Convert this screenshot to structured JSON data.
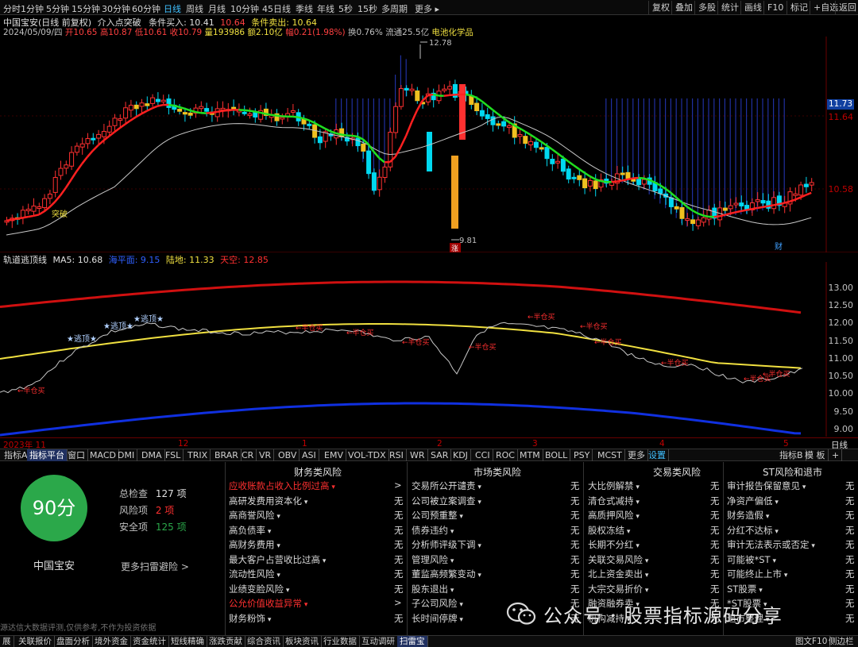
{
  "topbar": {
    "periods": [
      "分时",
      "1分钟",
      "5分钟",
      "15分钟",
      "30分钟",
      "60分钟",
      "日线",
      "周线",
      "月线",
      "10分钟",
      "45日线",
      "季线",
      "年线",
      "5秒",
      "15秒",
      "多周期",
      "更多 ▸"
    ],
    "right_buttons": [
      "复权",
      "叠加",
      "多股",
      "统计",
      "画线",
      "F10",
      "标记",
      "+自选",
      "返回"
    ],
    "active": "日线"
  },
  "main": {
    "title": "中国宝安(日线 前复权)",
    "cond1_label": "介入点突破",
    "cond2_label": "条件买入: 10.41",
    "cond2_extra": "10.64",
    "cond3_label": "条件卖出: 10.64",
    "info": {
      "date": "2024/05/09/四",
      "open": "开10.65",
      "high": "高10.87",
      "low": "低10.61",
      "close": "收10.79",
      "vol": "量193986",
      "amount": "额2.10亿",
      "change": "幅0.21(1.98%)",
      "turnover": "换0.76%",
      "float": "流通25.5亿",
      "sector": "电池化学品"
    },
    "y_labels": [
      "11.73",
      "11.64",
      "10.58"
    ],
    "hi_label": "12.78",
    "lo_label": "9.81",
    "break_label": "突破",
    "zhang_label": "涨",
    "cai_label": "财"
  },
  "indicator": {
    "name": "轨道逃顶线",
    "ma5": "MA5: 10.68",
    "sea": "海平面: 9.15",
    "land": "陆地: 11.33",
    "sky": "天空: 12.85",
    "y_labels": [
      "13.00",
      "12.50",
      "12.00",
      "11.50",
      "11.00",
      "10.50",
      "10.00",
      "9.50",
      "9.00"
    ],
    "top_label": "逃顶",
    "buy_label": "←半仓买"
  },
  "xaxis": {
    "labels": [
      "2023年 11",
      "12",
      "1",
      "2",
      "3",
      "4",
      "5"
    ],
    "period_label": "日线"
  },
  "tabs": [
    "指标A",
    "指标平台",
    "窗口",
    "MACD",
    "DMI",
    "DMA",
    "FSL",
    "TRIX",
    "BRAR",
    "CR",
    "VR",
    "OBV",
    "ASI",
    "EMV",
    "VOL-TDX",
    "RSI",
    "WR",
    "SAR",
    "KDJ",
    "CCI",
    "ROC",
    "MTM",
    "BOLL",
    "PSY",
    "MCST",
    "更多",
    "设置"
  ],
  "tabs_right": [
    "指标B",
    "模 板",
    "+"
  ],
  "scan": {
    "score": "90分",
    "stock": "中国宝安",
    "total_label": "总检查",
    "total_value": "127 项",
    "risk_label": "风险项",
    "risk_value": "2 项",
    "safe_label": "安全项",
    "safe_value": "125 项",
    "more": "更多扫雷避险 >",
    "disclaimer": "源达信大数据评测,仅供参考,不作为投资依据",
    "columns": [
      {
        "title": "财务类风险",
        "items": [
          {
            "label": "应收账款占收入比例过高",
            "value": ">",
            "risk": true
          },
          {
            "label": "高研发费用资本化",
            "value": "无"
          },
          {
            "label": "高商誉风险",
            "value": "无"
          },
          {
            "label": "高负债率",
            "value": "无"
          },
          {
            "label": "高财务费用",
            "value": "无"
          },
          {
            "label": "最大客户占营收比过高",
            "value": "无"
          },
          {
            "label": "流动性风险",
            "value": "无"
          },
          {
            "label": "业绩变脸风险",
            "value": "无"
          },
          {
            "label": "公允价值收益异常",
            "value": ">",
            "risk": true
          },
          {
            "label": "财务粉饰",
            "value": "无"
          }
        ]
      },
      {
        "title": "市场类风险",
        "items": [
          {
            "label": "交易所公开谴责",
            "value": "无"
          },
          {
            "label": "公司被立案调查",
            "value": "无"
          },
          {
            "label": "公司预重整",
            "value": "无"
          },
          {
            "label": "债券违约",
            "value": "无"
          },
          {
            "label": "分析师评级下调",
            "value": "无"
          },
          {
            "label": "管理风险",
            "value": "无"
          },
          {
            "label": "董监高频繁变动",
            "value": "无"
          },
          {
            "label": "股东退出",
            "value": "无"
          },
          {
            "label": "子公司风险",
            "value": "无"
          },
          {
            "label": "长时间停牌",
            "value": "无"
          }
        ]
      },
      {
        "title": "交易类风险",
        "items": [
          {
            "label": "大比例解禁",
            "value": "无"
          },
          {
            "label": "清仓式减持",
            "value": "无"
          },
          {
            "label": "高质押风险",
            "value": "无"
          },
          {
            "label": "股权冻结",
            "value": "无"
          },
          {
            "label": "长期不分红",
            "value": "无"
          },
          {
            "label": "关联交易风险",
            "value": "无"
          },
          {
            "label": "北上资金卖出",
            "value": "无"
          },
          {
            "label": "大宗交易折价",
            "value": "无"
          },
          {
            "label": "融资融券卖",
            "value": "无"
          },
          {
            "label": "机构减持",
            "value": "无"
          }
        ]
      },
      {
        "title": "ST风险和退市",
        "items": [
          {
            "label": "审计报告保留意见",
            "value": "无"
          },
          {
            "label": "净资产偏低",
            "value": "无"
          },
          {
            "label": "财务造假",
            "value": "无"
          },
          {
            "label": "分红不达标",
            "value": "无"
          },
          {
            "label": "审计无法表示或否定",
            "value": "无"
          },
          {
            "label": "可能被*ST",
            "value": "无"
          },
          {
            "label": "可能终止上市",
            "value": "无"
          },
          {
            "label": "ST股票",
            "value": "无"
          },
          {
            "label": "*ST股票",
            "value": "无"
          },
          {
            "label": "退市整理",
            "value": "无"
          }
        ]
      }
    ]
  },
  "watermark": "公众号 · 股票指标源码分享",
  "bottom_tabs": [
    "展",
    "关联报价",
    "盘面分析",
    "境外资金",
    "资金统计",
    "短线精确",
    "涨跌贡献",
    "综合资讯",
    "板块资讯",
    "行业数据",
    "互动调研",
    "扫雷宝"
  ],
  "bottom_right": [
    "图文F10",
    "侧边栏"
  ],
  "colors": {
    "up": "#ff3030",
    "down": "#00e0e0",
    "ma_red": "#ff2020",
    "ma_green": "#20e020",
    "sky": "#d01010",
    "land": "#f0e040",
    "sea": "#1030e0",
    "ma5_line": "#c8c8c8",
    "score_bg": "#2ba84a"
  }
}
